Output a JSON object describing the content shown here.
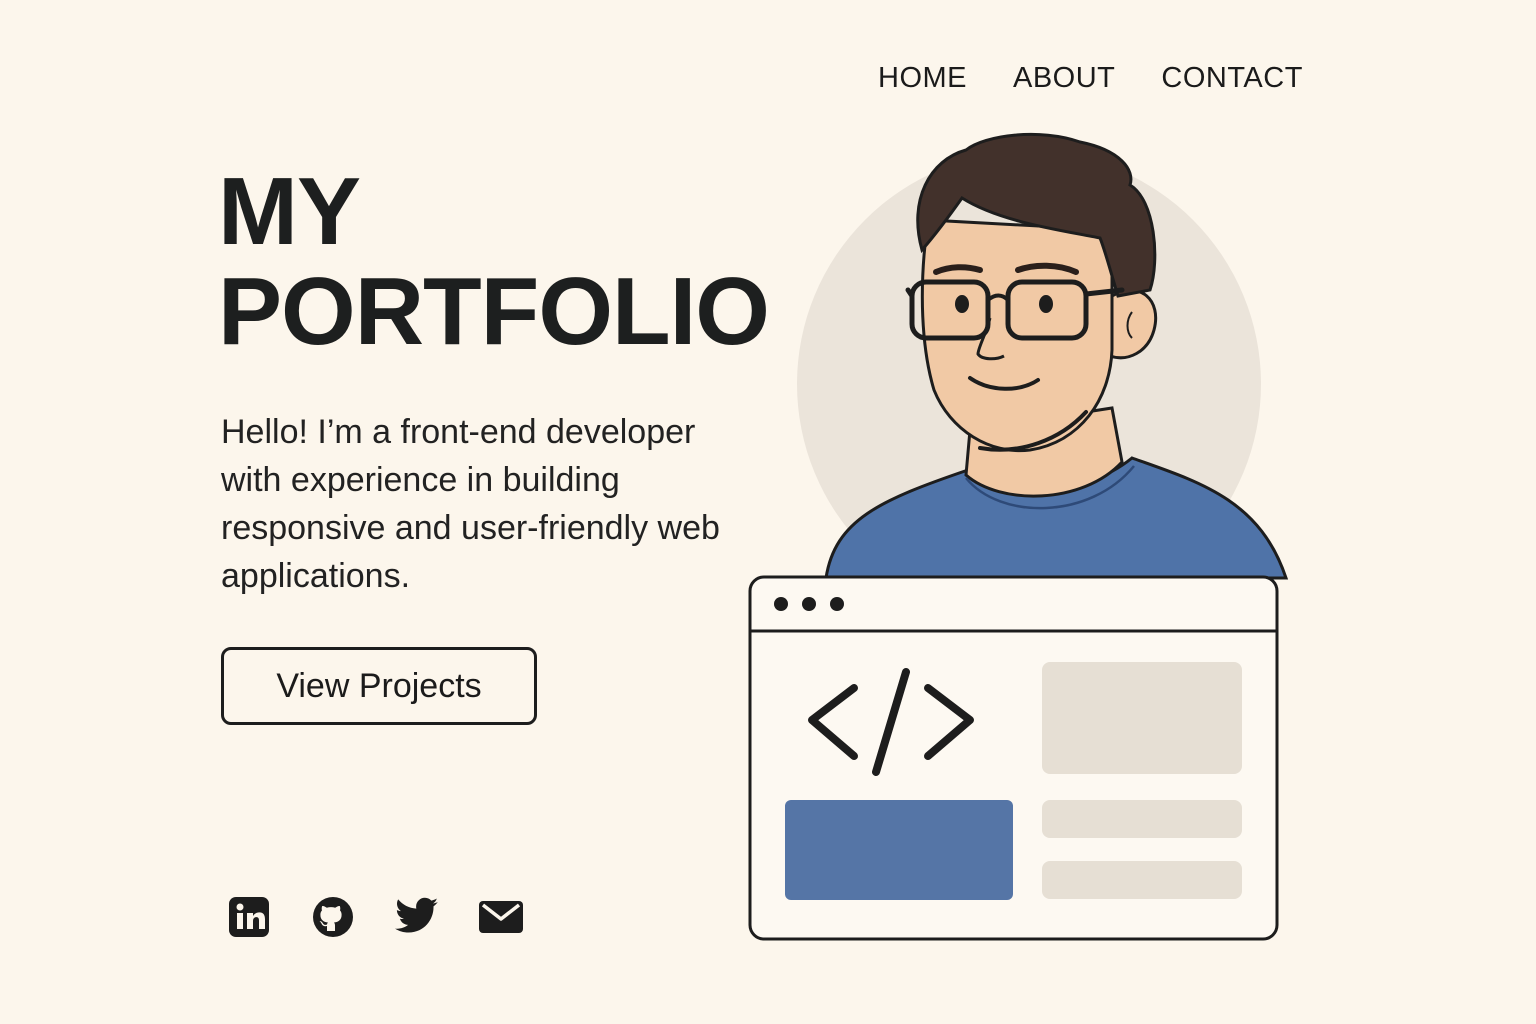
{
  "nav": {
    "items": [
      {
        "label": "HOME"
      },
      {
        "label": "ABOUT"
      },
      {
        "label": "CONTACT"
      }
    ]
  },
  "hero": {
    "title_line1": "MY",
    "title_line2": "PORTFOLIO",
    "intro": "Hello! I’m a front-end developer with experience in building responsive and user-friendly web applications.",
    "cta_label": "View Projects"
  },
  "socials": [
    {
      "icon": "linkedin-icon"
    },
    {
      "icon": "github-icon"
    },
    {
      "icon": "twitter-icon"
    },
    {
      "icon": "email-icon"
    }
  ],
  "illustration": {
    "code_symbol": "</>",
    "colors": {
      "background": "#fcf6ec",
      "circle": "#ebe4da",
      "skin": "#f1c9a5",
      "hair": "#42312b",
      "shirt": "#4f73a8",
      "accent_block": "#5575a6",
      "placeholder": "#e6dfd4",
      "outline": "#1d1d1d"
    }
  }
}
